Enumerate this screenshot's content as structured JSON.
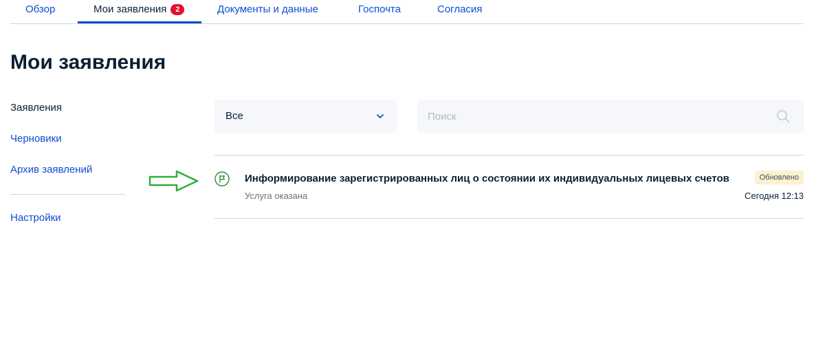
{
  "tabs": [
    {
      "label": "Обзор"
    },
    {
      "label": "Мои заявления",
      "badge": "2",
      "active": true
    },
    {
      "label": "Документы и данные"
    },
    {
      "label": "Госпочта"
    },
    {
      "label": "Согласия"
    }
  ],
  "page": {
    "title": "Мои заявления"
  },
  "sidebar": {
    "items": [
      {
        "label": "Заявления",
        "current": true
      },
      {
        "label": "Черновики"
      },
      {
        "label": "Архив заявлений"
      }
    ],
    "settings_label": "Настройки"
  },
  "filters": {
    "select_value": "Все",
    "search_placeholder": "Поиск",
    "search_value": ""
  },
  "applications": [
    {
      "title": "Информирование зарегистрированных лиц о состоянии их индивидуальных лицевых счетов",
      "status": "Услуга оказана",
      "badge": "Обновлено",
      "time": "Сегодня 12:13",
      "status_icon": "flag-icon"
    }
  ],
  "colors": {
    "accent": "#0d4cd3",
    "badge_red": "#e2102e",
    "status_green": "#2f8a3a",
    "updated_badge_bg": "#fdf1d0",
    "annotation_arrow": "#2fae3a"
  }
}
